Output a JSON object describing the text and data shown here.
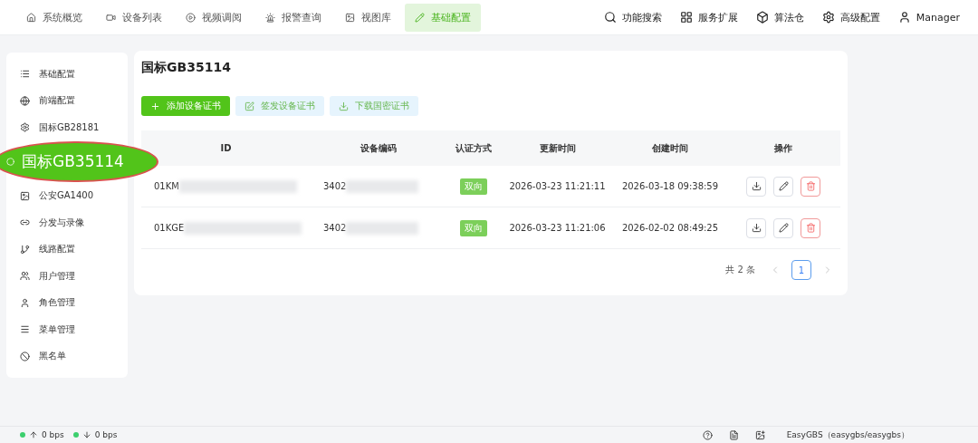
{
  "top_nav": {
    "items": [
      {
        "label": "系统概览",
        "selected": false
      },
      {
        "label": "设备列表",
        "selected": false
      },
      {
        "label": "视频调阅",
        "selected": false
      },
      {
        "label": "报警查询",
        "selected": false
      },
      {
        "label": "视图库",
        "selected": false
      },
      {
        "label": "基础配置",
        "selected": true
      }
    ],
    "tools": [
      "功能搜索",
      "服务扩展",
      "算法仓",
      "高级配置",
      "Manager"
    ]
  },
  "sidebar": {
    "items": [
      {
        "label": "基础配置",
        "selected": false
      },
      {
        "label": "前端配置",
        "selected": false
      },
      {
        "label": "国标GB28181",
        "selected": false
      },
      {
        "label": "国标GB35114",
        "selected": true
      },
      {
        "label": "公安GA1400",
        "selected": false
      },
      {
        "label": "分发与录像",
        "selected": false
      },
      {
        "label": "线路配置",
        "selected": false
      },
      {
        "label": "用户管理",
        "selected": false
      },
      {
        "label": "角色管理",
        "selected": false
      },
      {
        "label": "菜单管理",
        "selected": false
      },
      {
        "label": "黑名单",
        "selected": false
      }
    ]
  },
  "panel": {
    "title": "国标GB35114",
    "buttons": [
      {
        "label": "添加设备证书",
        "kind": "primary"
      },
      {
        "label": "签发设备证书",
        "kind": "light"
      },
      {
        "label": "下载国密证书",
        "kind": "light"
      }
    ],
    "table": {
      "columns": [
        "ID",
        "设备编码",
        "认证方式",
        "更新时间",
        "创建时间",
        "操作"
      ],
      "rows": [
        {
          "id": "01KM",
          "code": "3402",
          "auth": "双向",
          "updated": "2026-03-23 11:21:11",
          "created": "2026-03-18 09:38:59"
        },
        {
          "id": "01KGE",
          "code": "3402",
          "auth": "双向",
          "updated": "2026-03-23 11:21:06",
          "created": "2026-02-02 08:49:25"
        }
      ]
    },
    "pagination": {
      "total": "共 2 条",
      "pages": [
        {
          "label": "1",
          "selected": true
        }
      ]
    }
  },
  "status_bar": {
    "upload": "0 bps",
    "download": "0 bps",
    "account": "EasyGBS（easygbs/easygbs）"
  }
}
